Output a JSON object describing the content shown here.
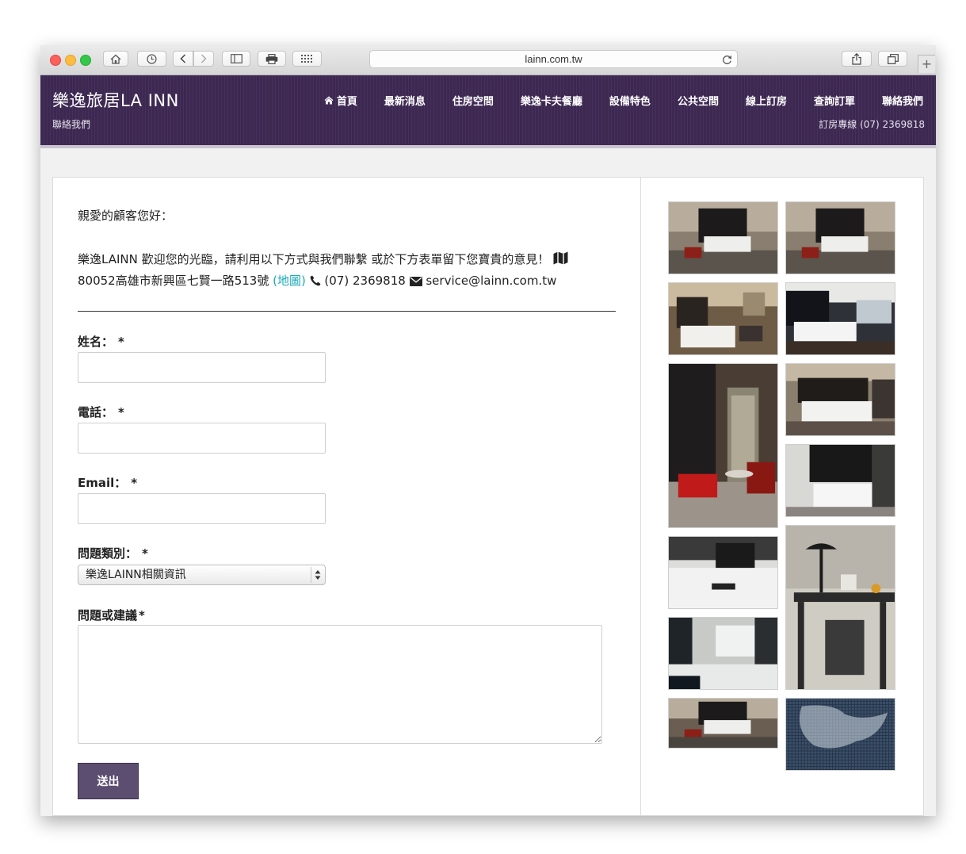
{
  "browser": {
    "url": "lainn.com.tw",
    "new_tab_glyph": "+"
  },
  "header": {
    "brand": "樂逸旅居LA INN",
    "contact_link": "聯絡我們",
    "booking_phone": "訂房專線 (07) 2369818",
    "nav": [
      {
        "label": "首頁",
        "icon": "home-icon"
      },
      {
        "label": "最新消息"
      },
      {
        "label": "住房空間"
      },
      {
        "label": "樂逸卡夫餐廳"
      },
      {
        "label": "設備特色"
      },
      {
        "label": "公共空間"
      },
      {
        "label": "線上訂房"
      },
      {
        "label": "查詢訂單"
      },
      {
        "label": "聯絡我們"
      }
    ]
  },
  "contact": {
    "greeting": "親愛的顧客您好：",
    "intro": "樂逸LAINN 歡迎您的光臨，請利用以下方式與我們聯繫 或於下方表單留下您寶貴的意見！",
    "address": "80052高雄市新興區七賢一路513號",
    "map_link": "(地圖)",
    "phone": "(07) 2369818",
    "email": "service@lainn.com.tw"
  },
  "form": {
    "name_label": "姓名：",
    "phone_label": "電話：",
    "email_label": "Email：",
    "category_label": "問題類別：",
    "category_selected": "樂逸LAINN相關資訊",
    "message_label": "問題或建議",
    "required_mark": "*",
    "submit_label": "送出"
  },
  "gallery": {
    "images": [
      "hotel-room-photo",
      "hotel-room-photo",
      "hotel-room-photo",
      "hotel-room-photo",
      "hotel-room-photo",
      "hotel-room-photo",
      "hotel-room-photo",
      "hotel-room-photo",
      "hotel-room-photo",
      "hotel-room-photo",
      "hotel-room-photo",
      "mosaic-tile-photo"
    ]
  }
}
